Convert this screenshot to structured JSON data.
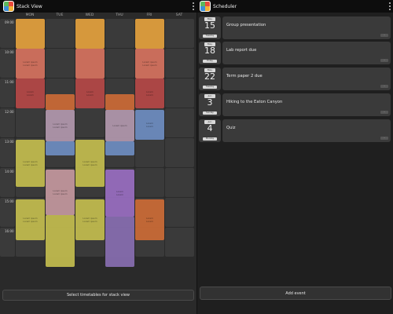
{
  "stack_view": {
    "title": "Stack View",
    "days": [
      "MON",
      "TUE",
      "WED",
      "THU",
      "FRI",
      "SAT"
    ],
    "times": [
      "09:00",
      "10:00",
      "11:00",
      "12:00",
      "13:00",
      "14:00",
      "15:00",
      "16:00"
    ],
    "events": [
      {
        "color": "#e8a33d",
        "line1": "",
        "line2": ""
      },
      {
        "color": "#d9735f",
        "line1": "Lorem ipsum",
        "line2": "Lorem ipsum"
      },
      {
        "color": "#b84847",
        "line1": "Lorem",
        "line2": "Lorem"
      },
      {
        "color": "#e8a33d",
        "line1": "",
        "line2": ""
      },
      {
        "color": "#d9735f",
        "line1": "",
        "line2": ""
      },
      {
        "color": "#b84847",
        "line1": "Lorem",
        "line2": "Lorem"
      },
      {
        "color": "#e8a33d",
        "line1": "",
        "line2": ""
      },
      {
        "color": "#d9735f",
        "line1": "Lorem ipsum",
        "line2": "Lorem ipsum"
      },
      {
        "color": "#b84847",
        "line1": "Lorem",
        "line2": "Lorem"
      },
      {
        "color": "#cf6c36",
        "line1": "",
        "line2": ""
      },
      {
        "color": "#cf6c36",
        "line1": "",
        "line2": ""
      },
      {
        "color": "#b59ab0",
        "line1": "Lorem ipsum",
        "line2": "Lorem ipsum"
      },
      {
        "color": "#b59ab0",
        "line1": "Lorem ipsum",
        "line2": ""
      },
      {
        "color": "#6f8fc4",
        "line1": "Lorem",
        "line2": "Lorem"
      },
      {
        "color": "#6f8fc4",
        "line1": "",
        "line2": ""
      },
      {
        "color": "#6f8fc4",
        "line1": "",
        "line2": ""
      },
      {
        "color": "#c6c04f",
        "line1": "Lorem ipsum",
        "line2": "Lorem ipsum"
      },
      {
        "color": "#c6c04f",
        "line1": "Lorem ipsum",
        "line2": "Lorem ipsum"
      },
      {
        "color": "#c79aa1",
        "line1": "Lorem ipsum",
        "line2": "Lorem ipsum"
      },
      {
        "color": "#9b6fc4",
        "line1": "Lorem",
        "line2": "Lorem"
      },
      {
        "color": "#c6c04f",
        "line1": "Lorem ipsum",
        "line2": "Lorem ipsum"
      },
      {
        "color": "#c6c04f",
        "line1": "",
        "line2": ""
      },
      {
        "color": "#c6c04f",
        "line1": "Lorem ipsum",
        "line2": "Lorem ipsum"
      },
      {
        "color": "#8a6fb4",
        "line1": "",
        "line2": ""
      },
      {
        "color": "#cf6c36",
        "line1": "Lorem",
        "line2": "Lorem"
      }
    ],
    "button_label": "Select timetables for stack view"
  },
  "scheduler": {
    "title": "Scheduler",
    "events": [
      {
        "month": "May",
        "day": "15",
        "weekday": "Tuesday",
        "title": "Group presentation",
        "tag": "..."
      },
      {
        "month": "May",
        "day": "18",
        "weekday": "Friday",
        "title": "Lab report due",
        "tag": "..."
      },
      {
        "month": "May",
        "day": "22",
        "weekday": "Tuesday",
        "title": "Term paper 2 due",
        "tag": "..."
      },
      {
        "month": "Jun",
        "day": "3",
        "weekday": "Sunday",
        "title": "Hiking to the Eaton Canyon",
        "tag": "..."
      },
      {
        "month": "Jun",
        "day": "4",
        "weekday": "Monday",
        "title": "Quiz",
        "tag": "..."
      }
    ],
    "button_label": "Add event"
  }
}
